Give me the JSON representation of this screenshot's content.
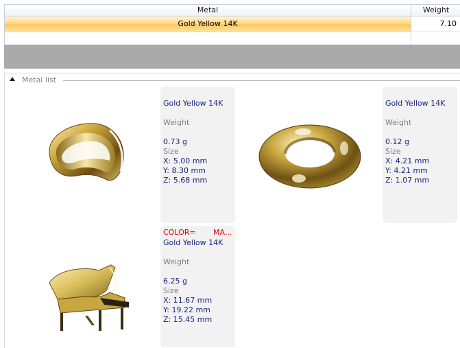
{
  "grid": {
    "columns": [
      "Metal",
      "Weight"
    ],
    "selected_row": {
      "metal": "Gold Yellow 14K",
      "weight": "7.10"
    }
  },
  "metal_list": {
    "title": "Metal list",
    "items": [
      {
        "thumbnail": "ring-icon",
        "color_label": "",
        "color_value": "",
        "name": "Gold Yellow 14K",
        "weight_label": "Weight",
        "weight_value": "0.73 g",
        "size_label": "Size",
        "x": "X: 5.00 mm",
        "y": "Y: 8.30 mm",
        "z": "Z: 5.68 mm"
      },
      {
        "thumbnail": "torus-icon",
        "color_label": "",
        "color_value": "",
        "name": "Gold Yellow 14K",
        "weight_label": "Weight",
        "weight_value": "0.12 g",
        "size_label": "Size",
        "x": "X: 4.21 mm",
        "y": "Y: 4.21 mm",
        "z": "Z: 1.07 mm"
      },
      {
        "thumbnail": "piano-icon",
        "color_label": "COLOR=",
        "color_value": "MA...",
        "name": "Gold Yellow 14K",
        "weight_label": "Weight",
        "weight_value": "6.25 g",
        "size_label": "Size",
        "x": "X: 11.67 mm",
        "y": "Y: 19.22 mm",
        "z": "Z: 15.45 mm"
      }
    ]
  },
  "colors": {
    "selection_gold": "#ffd98a",
    "name_text": "#1a237e",
    "muted_text": "#808080",
    "alert_text": "#e00000",
    "gray_band": "#aaaaaa"
  }
}
